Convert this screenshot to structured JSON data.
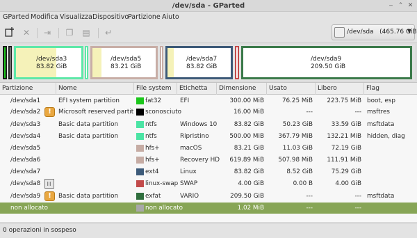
{
  "window": {
    "title": "/dev/sda - GParted"
  },
  "menu": [
    "GParted",
    "Modifica",
    "Visualizza",
    "Dispositivo",
    "Partizione",
    "Aiuto"
  ],
  "toolbar": {
    "new_icon": "new-partition-icon",
    "delete_icon": "delete-icon",
    "resize_icon": "resize-move-icon",
    "copy_icon": "copy-icon",
    "paste_icon": "paste-icon",
    "apply_icon": "undo-apply-icon"
  },
  "device": {
    "name": "/dev/sda",
    "size": "(465.76 GiB)"
  },
  "diskmap": [
    {
      "name": "/dev/sda3",
      "size": "83.82 GiB",
      "color": "#5ee8a8"
    },
    {
      "name": "/dev/sda5",
      "size": "83.21 GiB",
      "color": "#c8aea6"
    },
    {
      "name": "/dev/sda7",
      "size": "83.82 GiB",
      "color": "#3d5a78"
    },
    {
      "name": "/dev/sda9",
      "size": "209.50 GiB",
      "color": "#3b7a4a"
    }
  ],
  "columns": [
    "Partizione",
    "Nome",
    "File system",
    "Etichetta",
    "Dimensione",
    "Usato",
    "Libero",
    "Flag"
  ],
  "rows": [
    {
      "partition": "/dev/sda1",
      "name": "EFI system partition",
      "fs": "fat32",
      "fs_color": "#1bc71b",
      "label": "EFI",
      "size": "300.00 MiB",
      "used": "76.25 MiB",
      "free": "223.75 MiB",
      "flags": "boot, esp",
      "icon": ""
    },
    {
      "partition": "/dev/sda2",
      "name": "Microsoft reserved partition",
      "fs": "sconosciuto",
      "fs_color": "#000000",
      "label": "",
      "size": "16.00 MiB",
      "used": "---",
      "free": "---",
      "flags": "msftres",
      "icon": "warning-icon"
    },
    {
      "partition": "/dev/sda3",
      "name": "Basic data partition",
      "fs": "ntfs",
      "fs_color": "#4be4a4",
      "label": "Windows 10",
      "size": "83.82 GiB",
      "used": "50.23 GiB",
      "free": "33.59 GiB",
      "flags": "msftdata",
      "icon": ""
    },
    {
      "partition": "/dev/sda4",
      "name": "Basic data partition",
      "fs": "ntfs",
      "fs_color": "#4be4a4",
      "label": "Ripristino",
      "size": "500.00 MiB",
      "used": "367.79 MiB",
      "free": "132.21 MiB",
      "flags": "hidden, diag",
      "icon": ""
    },
    {
      "partition": "/dev/sda5",
      "name": "",
      "fs": "hfs+",
      "fs_color": "#c6aca4",
      "label": "macOS",
      "size": "83.21 GiB",
      "used": "11.03 GiB",
      "free": "72.19 GiB",
      "flags": "",
      "icon": ""
    },
    {
      "partition": "/dev/sda6",
      "name": "",
      "fs": "hfs+",
      "fs_color": "#c6aca4",
      "label": "Recovery HD",
      "size": "619.89 MiB",
      "used": "507.98 MiB",
      "free": "111.91 MiB",
      "flags": "",
      "icon": ""
    },
    {
      "partition": "/dev/sda7",
      "name": "",
      "fs": "ext4",
      "fs_color": "#3c5a79",
      "label": "Linux",
      "size": "83.82 GiB",
      "used": "8.52 GiB",
      "free": "75.29 GiB",
      "flags": "",
      "icon": ""
    },
    {
      "partition": "/dev/sda8",
      "name": "",
      "fs": "linux-swap",
      "fs_color": "#c24a4a",
      "label": "SWAP",
      "size": "4.00 GiB",
      "used": "0.00 B",
      "free": "4.00 GiB",
      "flags": "",
      "icon": "lock-icon"
    },
    {
      "partition": "/dev/sda9",
      "name": "Basic data partition",
      "fs": "exfat",
      "fs_color": "#2f6e3d",
      "label": "VARIO",
      "size": "209.50 GiB",
      "used": "---",
      "free": "---",
      "flags": "msftdata",
      "icon": "warning-icon"
    },
    {
      "partition": "non allocato",
      "name": "",
      "fs": "non allocato",
      "fs_color": "#a8a8a8",
      "label": "",
      "size": "1.02 MiB",
      "used": "---",
      "free": "---",
      "flags": "",
      "icon": ""
    }
  ],
  "status": "0 operazioni in sospeso"
}
